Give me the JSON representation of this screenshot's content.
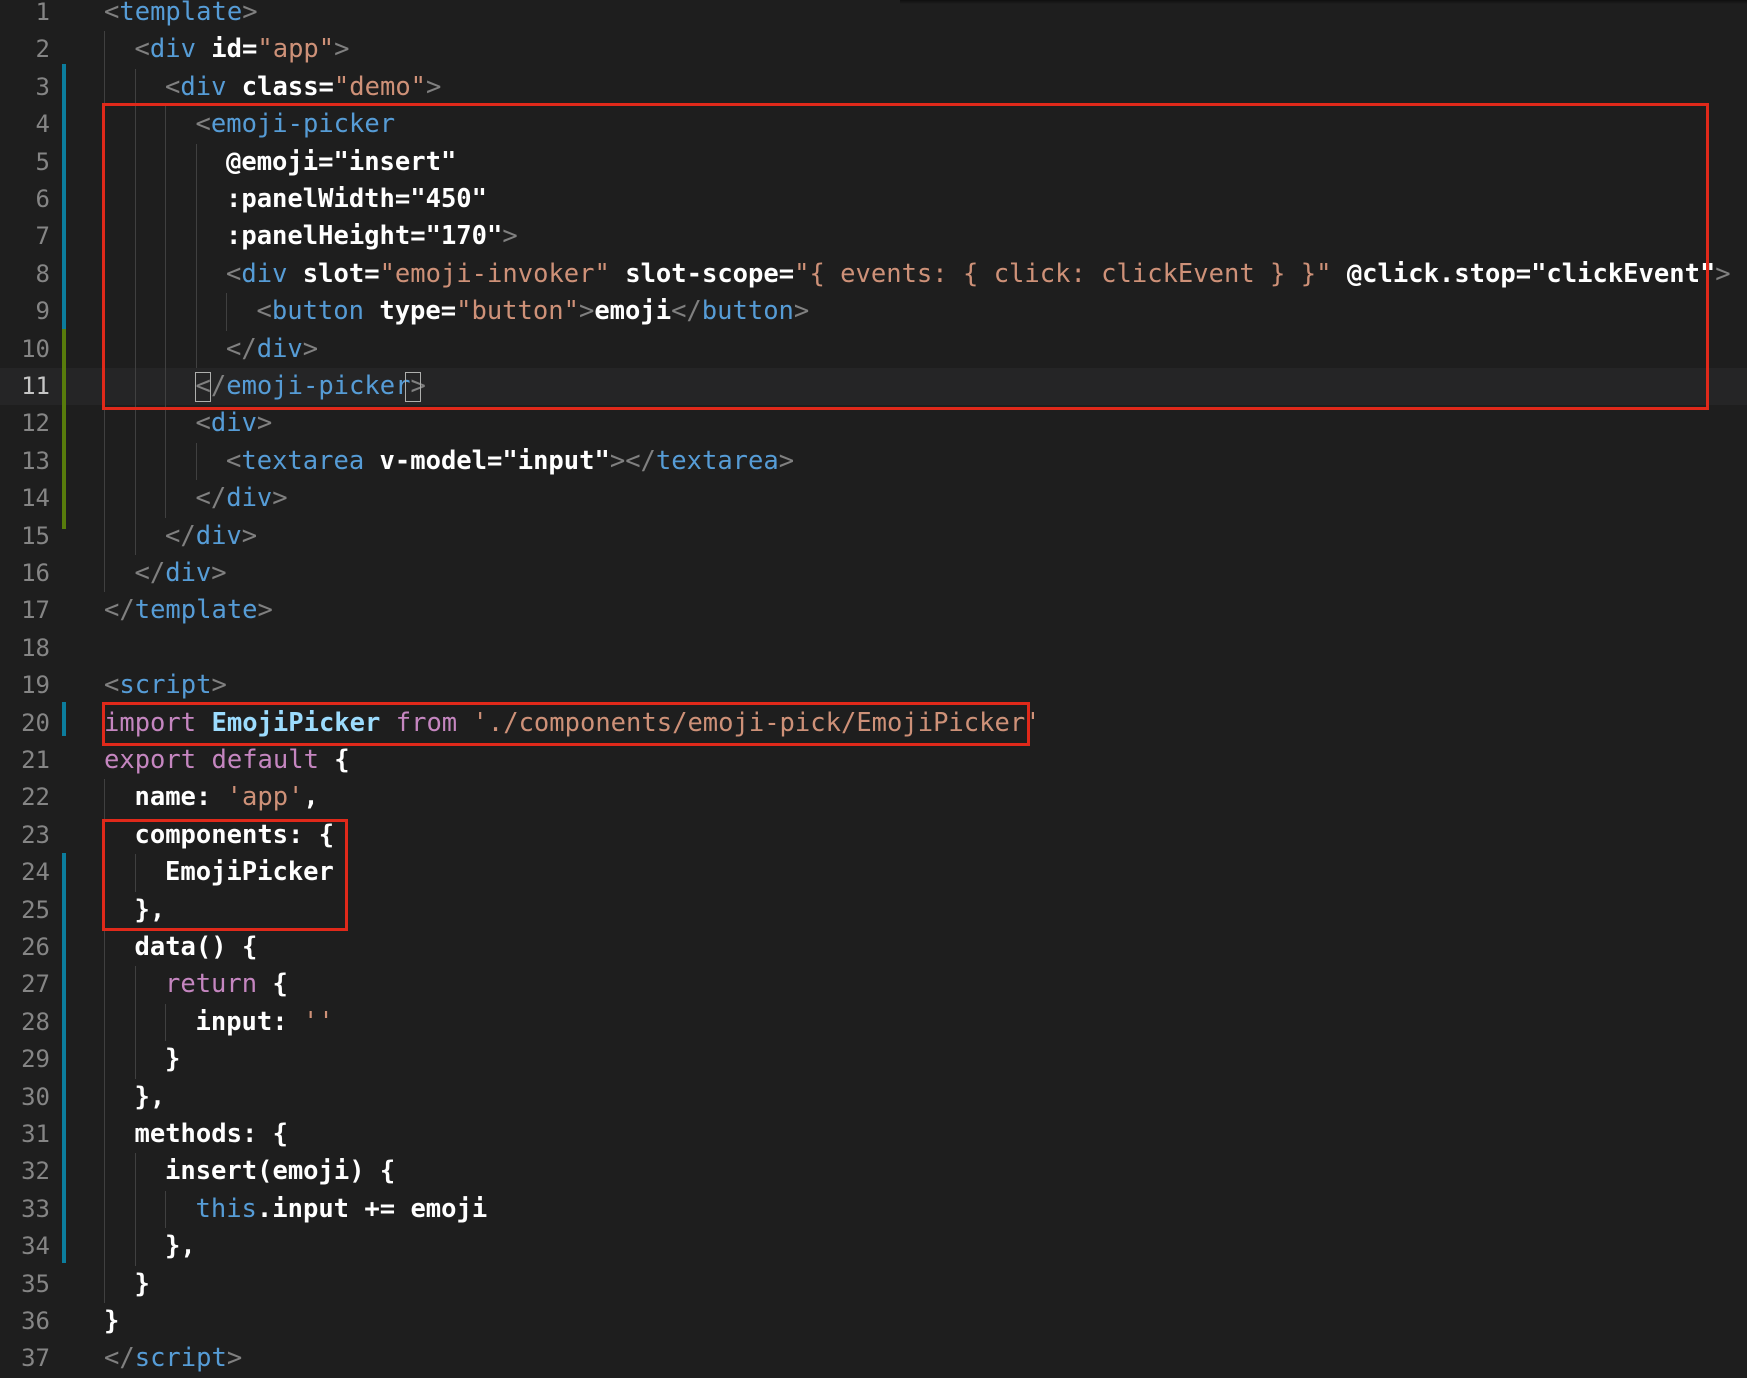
{
  "editor": {
    "current_line": 11,
    "lines": [
      {
        "n": "1",
        "indent": 0,
        "tokens": [
          [
            "punc",
            "<"
          ],
          [
            "tag",
            "template"
          ],
          [
            "punc",
            ">"
          ]
        ]
      },
      {
        "n": "2",
        "indent": 1,
        "tokens": [
          [
            "punc",
            "<"
          ],
          [
            "tag",
            "div"
          ],
          [
            "plain",
            " "
          ],
          [
            "attr",
            "id"
          ],
          [
            "plain",
            "="
          ],
          [
            "str",
            "\"app\""
          ],
          [
            "punc",
            ">"
          ]
        ]
      },
      {
        "n": "3",
        "indent": 2,
        "tokens": [
          [
            "punc",
            "<"
          ],
          [
            "tag",
            "div"
          ],
          [
            "plain",
            " "
          ],
          [
            "attr",
            "class"
          ],
          [
            "plain",
            "="
          ],
          [
            "str",
            "\"demo\""
          ],
          [
            "punc",
            ">"
          ]
        ]
      },
      {
        "n": "4",
        "indent": 3,
        "tokens": [
          [
            "punc",
            "<"
          ],
          [
            "tag",
            "emoji-picker"
          ]
        ]
      },
      {
        "n": "5",
        "indent": 4,
        "tokens": [
          [
            "attr",
            "@emoji"
          ],
          [
            "plain",
            "="
          ],
          [
            "text",
            "\"insert\""
          ]
        ]
      },
      {
        "n": "6",
        "indent": 4,
        "tokens": [
          [
            "attr",
            ":panelWidth"
          ],
          [
            "plain",
            "="
          ],
          [
            "text",
            "\"450\""
          ]
        ]
      },
      {
        "n": "7",
        "indent": 4,
        "tokens": [
          [
            "attr",
            ":panelHeight"
          ],
          [
            "plain",
            "="
          ],
          [
            "text",
            "\"170\""
          ],
          [
            "punc",
            ">"
          ]
        ]
      },
      {
        "n": "8",
        "indent": 4,
        "tokens": [
          [
            "punc",
            "<"
          ],
          [
            "tag",
            "div"
          ],
          [
            "plain",
            " "
          ],
          [
            "attr",
            "slot"
          ],
          [
            "plain",
            "="
          ],
          [
            "str",
            "\"emoji-invoker\""
          ],
          [
            "plain",
            " "
          ],
          [
            "attr",
            "slot-scope"
          ],
          [
            "plain",
            "="
          ],
          [
            "str",
            "\"{ events: { click: clickEvent } }\""
          ],
          [
            "plain",
            " "
          ],
          [
            "attr",
            "@click.stop"
          ],
          [
            "plain",
            "="
          ],
          [
            "text",
            "\"clickEvent\""
          ],
          [
            "punc",
            ">"
          ]
        ]
      },
      {
        "n": "9",
        "indent": 5,
        "tokens": [
          [
            "punc",
            "<"
          ],
          [
            "tag",
            "button"
          ],
          [
            "plain",
            " "
          ],
          [
            "attr",
            "type"
          ],
          [
            "plain",
            "="
          ],
          [
            "str",
            "\"button\""
          ],
          [
            "punc",
            ">"
          ],
          [
            "text",
            "emoji"
          ],
          [
            "punc",
            "</"
          ],
          [
            "tag",
            "button"
          ],
          [
            "punc",
            ">"
          ]
        ]
      },
      {
        "n": "10",
        "indent": 4,
        "tokens": [
          [
            "punc",
            "</"
          ],
          [
            "tag",
            "div"
          ],
          [
            "punc",
            ">"
          ]
        ]
      },
      {
        "n": "11",
        "indent": 3,
        "tokens": [
          [
            "punc",
            "</"
          ],
          [
            "tag",
            "emoji-picker"
          ],
          [
            "punc",
            ">"
          ]
        ]
      },
      {
        "n": "12",
        "indent": 3,
        "tokens": [
          [
            "punc",
            "<"
          ],
          [
            "tag",
            "div"
          ],
          [
            "punc",
            ">"
          ]
        ]
      },
      {
        "n": "13",
        "indent": 4,
        "tokens": [
          [
            "punc",
            "<"
          ],
          [
            "tag",
            "textarea"
          ],
          [
            "plain",
            " "
          ],
          [
            "attr",
            "v-model"
          ],
          [
            "plain",
            "="
          ],
          [
            "text",
            "\"input\""
          ],
          [
            "punc",
            "></"
          ],
          [
            "tag",
            "textarea"
          ],
          [
            "punc",
            ">"
          ]
        ]
      },
      {
        "n": "14",
        "indent": 3,
        "tokens": [
          [
            "punc",
            "</"
          ],
          [
            "tag",
            "div"
          ],
          [
            "punc",
            ">"
          ]
        ]
      },
      {
        "n": "15",
        "indent": 2,
        "tokens": [
          [
            "punc",
            "</"
          ],
          [
            "tag",
            "div"
          ],
          [
            "punc",
            ">"
          ]
        ]
      },
      {
        "n": "16",
        "indent": 1,
        "tokens": [
          [
            "punc",
            "</"
          ],
          [
            "tag",
            "div"
          ],
          [
            "punc",
            ">"
          ]
        ]
      },
      {
        "n": "17",
        "indent": 0,
        "tokens": [
          [
            "punc",
            "</"
          ],
          [
            "tag",
            "template"
          ],
          [
            "punc",
            ">"
          ]
        ]
      },
      {
        "n": "18",
        "indent": 0,
        "tokens": []
      },
      {
        "n": "19",
        "indent": 0,
        "tokens": [
          [
            "punc",
            "<"
          ],
          [
            "tag",
            "script"
          ],
          [
            "punc",
            ">"
          ]
        ]
      },
      {
        "n": "20",
        "indent": 0,
        "tokens": [
          [
            "kw",
            "import"
          ],
          [
            "plain",
            " "
          ],
          [
            "id",
            "EmojiPicker"
          ],
          [
            "plain",
            " "
          ],
          [
            "kw",
            "from"
          ],
          [
            "plain",
            " "
          ],
          [
            "str",
            "'./components/emoji-pick/EmojiPicker'"
          ]
        ]
      },
      {
        "n": "21",
        "indent": 0,
        "tokens": [
          [
            "kw",
            "export"
          ],
          [
            "plain",
            " "
          ],
          [
            "kw",
            "default"
          ],
          [
            "plain",
            " {"
          ]
        ]
      },
      {
        "n": "22",
        "indent": 1,
        "tokens": [
          [
            "plain",
            "name"
          ],
          [
            "plain",
            ": "
          ],
          [
            "str",
            "'app'"
          ],
          [
            "plain",
            ","
          ]
        ]
      },
      {
        "n": "23",
        "indent": 1,
        "tokens": [
          [
            "plain",
            "components"
          ],
          [
            "plain",
            ": {"
          ]
        ]
      },
      {
        "n": "24",
        "indent": 2,
        "tokens": [
          [
            "plain",
            "EmojiPicker"
          ]
        ]
      },
      {
        "n": "25",
        "indent": 1,
        "tokens": [
          [
            "plain",
            "},"
          ]
        ]
      },
      {
        "n": "26",
        "indent": 1,
        "tokens": [
          [
            "plain",
            "data() {"
          ]
        ]
      },
      {
        "n": "27",
        "indent": 2,
        "tokens": [
          [
            "kw",
            "return"
          ],
          [
            "plain",
            " {"
          ]
        ]
      },
      {
        "n": "28",
        "indent": 3,
        "tokens": [
          [
            "plain",
            "input: "
          ],
          [
            "str",
            "''"
          ]
        ]
      },
      {
        "n": "29",
        "indent": 2,
        "tokens": [
          [
            "plain",
            "}"
          ]
        ]
      },
      {
        "n": "30",
        "indent": 1,
        "tokens": [
          [
            "plain",
            "},"
          ]
        ]
      },
      {
        "n": "31",
        "indent": 1,
        "tokens": [
          [
            "plain",
            "methods: {"
          ]
        ]
      },
      {
        "n": "32",
        "indent": 2,
        "tokens": [
          [
            "plain",
            "insert(emoji) {"
          ]
        ]
      },
      {
        "n": "33",
        "indent": 3,
        "tokens": [
          [
            "this",
            "this"
          ],
          [
            "plain",
            ".input += emoji"
          ]
        ]
      },
      {
        "n": "34",
        "indent": 2,
        "tokens": [
          [
            "plain",
            "},"
          ]
        ]
      },
      {
        "n": "35",
        "indent": 1,
        "tokens": [
          [
            "plain",
            "}"
          ]
        ]
      },
      {
        "n": "36",
        "indent": 0,
        "tokens": [
          [
            "plain",
            "}"
          ]
        ]
      },
      {
        "n": "37",
        "indent": 0,
        "tokens": [
          [
            "punc",
            "</"
          ],
          [
            "tag",
            "script"
          ],
          [
            "punc",
            ">"
          ]
        ]
      }
    ]
  },
  "colors": {
    "background": "#1e1e1e",
    "highlight_box": "#e0291a",
    "git_modified": "#0c7d9d",
    "git_added": "#587c0c"
  }
}
